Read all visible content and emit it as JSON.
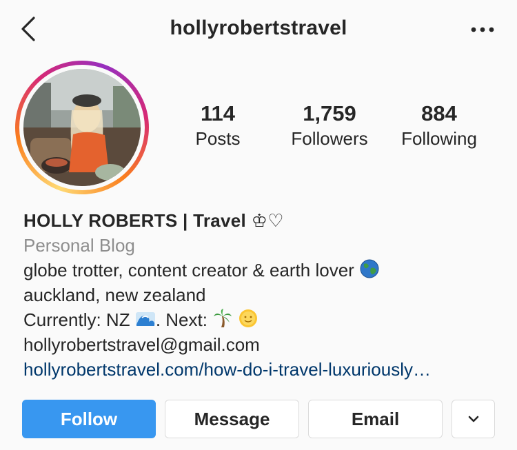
{
  "header": {
    "username": "hollyrobertstravel",
    "back_icon": "chevron-left-icon",
    "more_icon": "more-horizontal-icon"
  },
  "profile": {
    "avatar": "profile-photo",
    "story_ring_colors": [
      "#feda75",
      "#fa7e1e",
      "#d62976",
      "#962fbf"
    ]
  },
  "stats": [
    {
      "value": "114",
      "label": "Posts"
    },
    {
      "value": "1,759",
      "label": "Followers"
    },
    {
      "value": "884",
      "label": "Following"
    }
  ],
  "bio": {
    "name": "HOLLY ROBERTS  | Travel ♔♡",
    "category": "Personal Blog",
    "line1": "globe trotter, content creator & earth lover",
    "line1_emoji": "globe-emoji",
    "line2": "auckland, new zealand",
    "line3_a": "Currently: NZ",
    "line3_b": ". Next:",
    "line3_emojis": [
      "wave-emoji",
      "palm-tree-emoji",
      "sun-emoji"
    ],
    "email": "hollyrobertstravel@gmail.com",
    "link": "hollyrobertstravel.com/how-do-i-travel-luxuriously…"
  },
  "actions": {
    "follow": "Follow",
    "message": "Message",
    "email": "Email",
    "dropdown_icon": "chevron-down-icon"
  },
  "colors": {
    "follow_button": "#3897f0",
    "link": "#00376b",
    "secondary_text": "#8e8e8e"
  }
}
